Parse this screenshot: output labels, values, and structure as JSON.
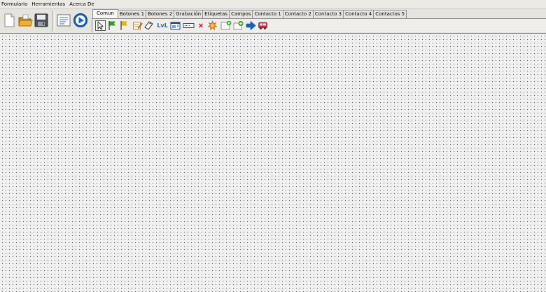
{
  "menubar": {
    "items": [
      {
        "label": "Formulario"
      },
      {
        "label": "Herramientas"
      },
      {
        "label": "Acerca De"
      }
    ]
  },
  "toolbar": {
    "buttons": [
      {
        "icon": "new-file-icon"
      },
      {
        "icon": "open-folder-icon"
      },
      {
        "icon": "save-disk-icon"
      },
      {
        "icon": "form-properties-icon"
      },
      {
        "icon": "run-play-icon"
      }
    ]
  },
  "tabs": {
    "items": [
      {
        "label": "Comun",
        "active": true
      },
      {
        "label": "Botones 1"
      },
      {
        "label": "Botones 2"
      },
      {
        "label": "Grabación"
      },
      {
        "label": "Etiquetas"
      },
      {
        "label": "Campos"
      },
      {
        "label": "Contacto 1"
      },
      {
        "label": "Contacto 2"
      },
      {
        "label": "Contacto 3"
      },
      {
        "label": "Contacto 4"
      },
      {
        "label": "Contactos 5"
      }
    ]
  },
  "palette": {
    "lvl_text": "LvL",
    "items": [
      {
        "icon": "pointer-arrow-icon",
        "selected": true
      },
      {
        "icon": "green-flag-icon"
      },
      {
        "icon": "yellow-flag-icon"
      },
      {
        "icon": "edit-note-icon"
      },
      {
        "icon": "eraser-icon"
      },
      {
        "icon": "label-lvl-icon"
      },
      {
        "icon": "frame-panel-icon"
      },
      {
        "icon": "textbox-icon"
      },
      {
        "icon": "delete-x-icon"
      },
      {
        "icon": "gear-star-icon"
      },
      {
        "icon": "add-window-icon"
      },
      {
        "icon": "add-green-plus-icon"
      },
      {
        "icon": "blue-arrow-right-icon"
      },
      {
        "icon": "red-bus-icon"
      }
    ]
  },
  "colors": {
    "accent_blue": "#1565c0",
    "flag_green": "#2e9d2e",
    "flag_yellow": "#e2b400",
    "folder_orange": "#e8a01c",
    "delete_red": "#d01010"
  }
}
